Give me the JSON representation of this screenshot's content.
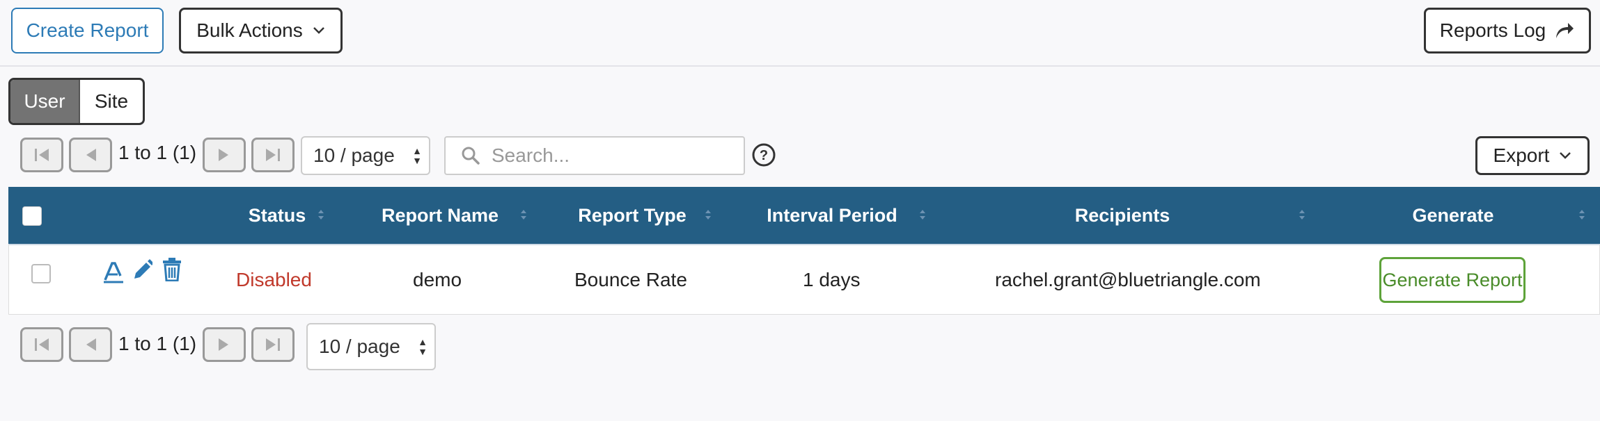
{
  "toolbar": {
    "create_label": "Create Report",
    "bulk_label": "Bulk Actions",
    "log_label": "Reports Log"
  },
  "scope": {
    "options": [
      "User",
      "Site"
    ],
    "selected": "User"
  },
  "pager_top": {
    "range_text": "1 to 1 (1)",
    "page_size": "10 / page"
  },
  "search": {
    "placeholder": "Search..."
  },
  "export_label": "Export",
  "table": {
    "columns": [
      "Status",
      "Report Name",
      "Report Type",
      "Interval Period",
      "Recipients",
      "Generate"
    ],
    "rows": [
      {
        "status": "Disabled",
        "name": "demo",
        "type": "Bounce Rate",
        "interval": "1 days",
        "recipients": "rachel.grant@bluetriangle.com",
        "generate_label": "Generate Report"
      }
    ]
  },
  "pager_bottom": {
    "range_text": "1 to 1 (1)",
    "page_size": "10 / page"
  },
  "colors": {
    "header_bg": "#245e84",
    "status_disabled": "#c0392b",
    "accent_blue": "#2d7bb6",
    "generate_green": "#5ea33a"
  }
}
